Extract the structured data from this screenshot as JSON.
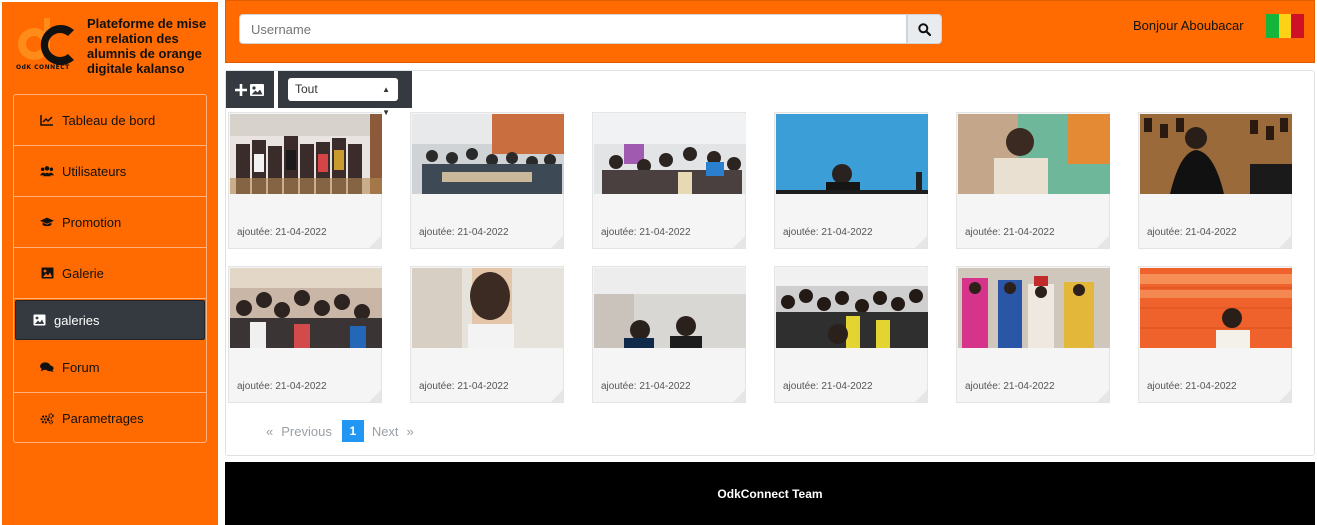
{
  "brand": {
    "logo_text": "OdK CONNECT",
    "title": "Plateforme de mise en relation des alumnis de orange digitale kalanso"
  },
  "sidebar": {
    "items": [
      {
        "label": "Tableau de bord",
        "icon": "chart-line-icon"
      },
      {
        "label": "Utilisateurs",
        "icon": "users-icon"
      },
      {
        "label": "Promotion",
        "icon": "graduation-cap-icon"
      },
      {
        "label": "Galerie",
        "icon": "image-icon"
      },
      {
        "label": "galeries",
        "icon": "image-icon",
        "active": true
      },
      {
        "label": "Forum",
        "icon": "comments-icon"
      },
      {
        "label": "Parametrages",
        "icon": "cogs-icon"
      }
    ]
  },
  "header": {
    "search_placeholder": "Username",
    "greeting": "Bonjour Aboubacar",
    "flag_colors": [
      "#14b53a",
      "#fcd116",
      "#ce1126"
    ]
  },
  "gallery": {
    "filter_value": "Tout",
    "items": [
      {
        "date": "ajoutée: 21-04-2022"
      },
      {
        "date": "ajoutée: 21-04-2022"
      },
      {
        "date": "ajoutée: 21-04-2022"
      },
      {
        "date": "ajoutée: 21-04-2022"
      },
      {
        "date": "ajoutée: 21-04-2022"
      },
      {
        "date": "ajoutée: 21-04-2022"
      },
      {
        "date": "ajoutée: 21-04-2022"
      },
      {
        "date": "ajoutée: 21-04-2022"
      },
      {
        "date": "ajoutée: 21-04-2022"
      },
      {
        "date": "ajoutée: 21-04-2022"
      },
      {
        "date": "ajoutée: 21-04-2022"
      },
      {
        "date": "ajoutée: 21-04-2022"
      }
    ],
    "pagination": {
      "first": "«",
      "previous": "Previous",
      "current": "1",
      "next": "Next",
      "last": "»"
    }
  },
  "footer": {
    "text": "OdkConnect Team"
  },
  "colors": {
    "accent": "#ff6b00",
    "dark": "#343a40",
    "page_active": "#2196f3"
  }
}
